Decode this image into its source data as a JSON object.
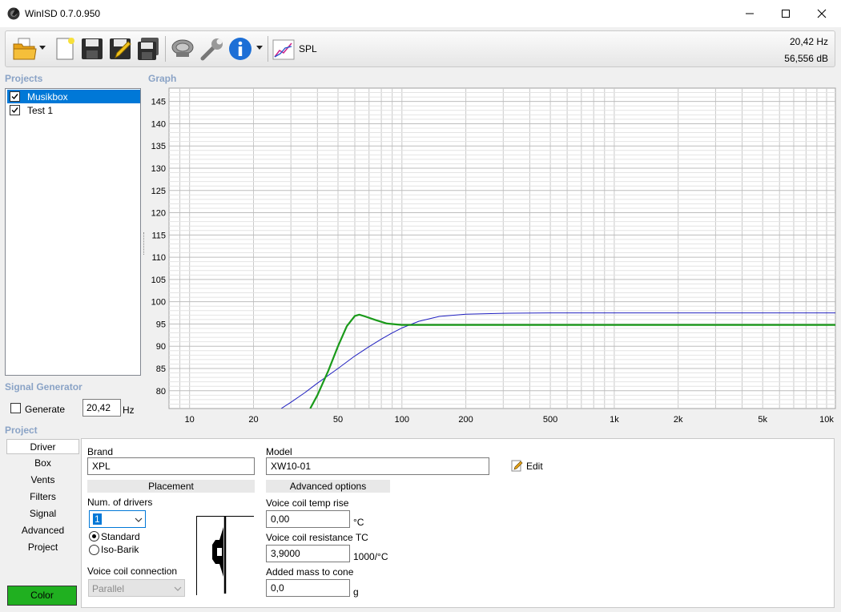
{
  "window": {
    "title": "WinISD 0.7.0.950"
  },
  "toolbar": {
    "icons": [
      "open-folder-icon",
      "new-document-icon",
      "save-icon",
      "save-as-icon",
      "save-all-icon",
      "driver-icon",
      "settings-wrench-icon",
      "info-icon",
      "spl-graph-icon"
    ],
    "graph_label": "SPL",
    "readout_freq": "20,42 Hz",
    "readout_db": "56,556 dB"
  },
  "projects": {
    "heading": "Projects",
    "items": [
      {
        "label": "Musikbox",
        "checked": true,
        "selected": true
      },
      {
        "label": "Test 1",
        "checked": true,
        "selected": false
      }
    ]
  },
  "graph": {
    "heading": "Graph"
  },
  "chart_data": {
    "type": "line",
    "x_scale": "log",
    "xlim": [
      8,
      11000
    ],
    "ylim": [
      76,
      148
    ],
    "x_ticks": [
      10,
      20,
      50,
      100,
      200,
      500,
      1000,
      2000,
      5000,
      10000
    ],
    "x_tick_labels": [
      "10",
      "20",
      "50",
      "100",
      "200",
      "500",
      "1k",
      "2k",
      "5k",
      "10k"
    ],
    "y_ticks": [
      80,
      85,
      90,
      95,
      100,
      105,
      110,
      115,
      120,
      125,
      130,
      135,
      140,
      145
    ],
    "grid": true,
    "series": [
      {
        "color": "#2020c0",
        "x": [
          27,
          30,
          35,
          40,
          50,
          60,
          70,
          80,
          90,
          100,
          120,
          150,
          200,
          300,
          500,
          1000,
          2000,
          5000,
          11000
        ],
        "y": [
          76,
          77.4,
          79.6,
          81.7,
          85,
          87.8,
          89.9,
          91.6,
          93,
          94.1,
          95.6,
          96.7,
          97.2,
          97.4,
          97.5,
          97.5,
          97.5,
          97.5,
          97.5
        ]
      },
      {
        "color": "#1a9a1a",
        "x": [
          37,
          40,
          45,
          50,
          55,
          60,
          63,
          67,
          75,
          85,
          100,
          120,
          150,
          300,
          1000,
          11000
        ],
        "y": [
          76,
          79,
          84.5,
          90,
          94.5,
          96.8,
          97.1,
          96.7,
          95.9,
          95.1,
          94.8,
          94.8,
          94.8,
          94.8,
          94.8,
          94.8
        ]
      }
    ]
  },
  "signal_generator": {
    "heading": "Signal Generator",
    "generate_label": "Generate",
    "generate_checked": false,
    "frequency": "20,42",
    "unit": "Hz"
  },
  "project": {
    "heading": "Project",
    "nav": [
      "Driver",
      "Box",
      "Vents",
      "Filters",
      "Signal",
      "Advanced",
      "Project"
    ],
    "selected_nav": "Driver",
    "color_label": "Color",
    "color_value": "#20b020"
  },
  "driver": {
    "brand_label": "Brand",
    "brand_value": "XPL",
    "model_label": "Model",
    "model_value": "XW10-01",
    "edit_label": "Edit",
    "placement_label": "Placement",
    "num_drivers_label": "Num. of drivers",
    "num_drivers_value": "1",
    "standard_label": "Standard",
    "isobarik_label": "Iso-Barik",
    "standard_selected": true,
    "voice_coil_conn_label": "Voice coil connection",
    "voice_coil_conn_value": "Parallel",
    "advanced_label": "Advanced options",
    "temp_rise_label": "Voice coil temp rise",
    "temp_rise_value": "0,00",
    "temp_rise_unit": "°C",
    "resistance_tc_label": "Voice coil resistance TC",
    "resistance_tc_value": "3,9000",
    "resistance_tc_unit": "1000/°C",
    "added_mass_label": "Added mass to cone",
    "added_mass_value": "0,0",
    "added_mass_unit": "g"
  }
}
